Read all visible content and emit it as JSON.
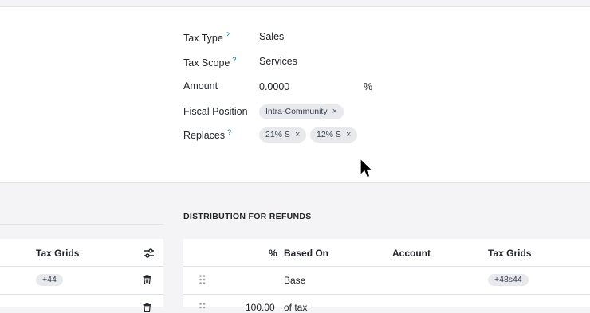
{
  "form": {
    "tax_type_label": "Tax Type",
    "tax_type_value": "Sales",
    "tax_scope_label": "Tax Scope",
    "tax_scope_value": "Services",
    "amount_label": "Amount",
    "amount_value": "0.0000",
    "amount_unit": "%",
    "fiscal_position_label": "Fiscal Position",
    "fiscal_position_tag": "Intra-Community",
    "replaces_label": "Replaces",
    "replaces_tags": [
      "21% S",
      "12% S"
    ],
    "help_mark": "?"
  },
  "remove_mark": "×",
  "refunds": {
    "title": "DISTRIBUTION FOR REFUNDS",
    "columns": [
      "%",
      "Based On",
      "Account",
      "Tax Grids"
    ],
    "rows": [
      {
        "percent": "",
        "based_on": "Base",
        "account": "",
        "tax_grids": "+48s44"
      },
      {
        "percent": "100.00",
        "based_on": "of tax",
        "account": "",
        "tax_grids": ""
      }
    ]
  },
  "invoices_partial": {
    "column": "Tax Grids",
    "rows": [
      {
        "tax_grids": "+44"
      }
    ]
  },
  "colors": {
    "accent": "#017e84",
    "tag_bg": "#e7e9ed",
    "background": "#f4f4f6"
  },
  "icons": [
    "settings-sliders-icon",
    "trash-icon",
    "drag-handle-icon",
    "pointer-cursor-icon"
  ]
}
